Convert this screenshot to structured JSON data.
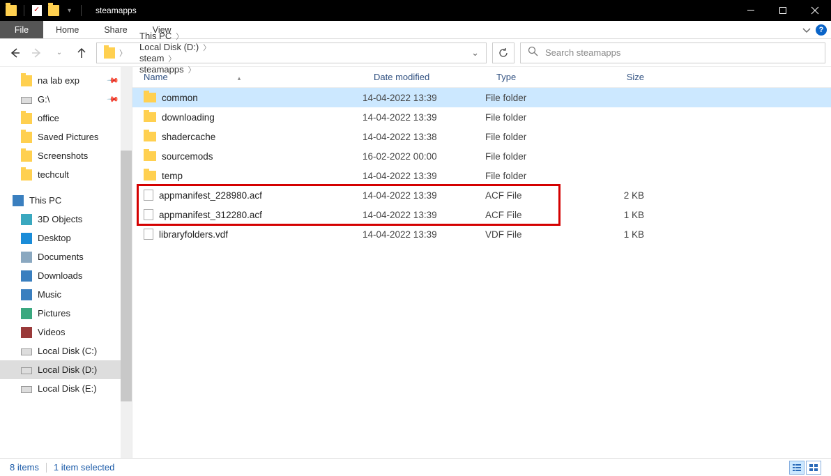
{
  "window": {
    "title": "steamapps"
  },
  "ribbon": {
    "file": "File",
    "home": "Home",
    "share": "Share",
    "view": "View"
  },
  "breadcrumbs": [
    "This PC",
    "Local Disk (D:)",
    "steam",
    "steamapps"
  ],
  "search": {
    "placeholder": "Search steamapps"
  },
  "sidebar": {
    "quick": [
      {
        "label": "na lab exp",
        "pinned": true,
        "icon": "folder"
      },
      {
        "label": "G:\\",
        "pinned": true,
        "icon": "drive"
      },
      {
        "label": "office",
        "pinned": false,
        "icon": "folder"
      },
      {
        "label": "Saved Pictures",
        "pinned": false,
        "icon": "folder"
      },
      {
        "label": "Screenshots",
        "pinned": false,
        "icon": "folder"
      },
      {
        "label": "techcult",
        "pinned": false,
        "icon": "folder"
      }
    ],
    "thispc_label": "This PC",
    "thispc": [
      {
        "label": "3D Objects",
        "icon": "obj"
      },
      {
        "label": "Desktop",
        "icon": "desk"
      },
      {
        "label": "Documents",
        "icon": "doc"
      },
      {
        "label": "Downloads",
        "icon": "dl"
      },
      {
        "label": "Music",
        "icon": "music"
      },
      {
        "label": "Pictures",
        "icon": "pic"
      },
      {
        "label": "Videos",
        "icon": "vid"
      },
      {
        "label": "Local Disk (C:)",
        "icon": "drive"
      },
      {
        "label": "Local Disk (D:)",
        "icon": "drive",
        "selected": true
      },
      {
        "label": "Local Disk (E:)",
        "icon": "drive"
      }
    ]
  },
  "columns": {
    "name": "Name",
    "date": "Date modified",
    "type": "Type",
    "size": "Size"
  },
  "files": [
    {
      "name": "common",
      "date": "14-04-2022 13:39",
      "type": "File folder",
      "size": "",
      "icon": "folder",
      "selected": true
    },
    {
      "name": "downloading",
      "date": "14-04-2022 13:39",
      "type": "File folder",
      "size": "",
      "icon": "folder"
    },
    {
      "name": "shadercache",
      "date": "14-04-2022 13:38",
      "type": "File folder",
      "size": "",
      "icon": "folder"
    },
    {
      "name": "sourcemods",
      "date": "16-02-2022 00:00",
      "type": "File folder",
      "size": "",
      "icon": "folder"
    },
    {
      "name": "temp",
      "date": "14-04-2022 13:39",
      "type": "File folder",
      "size": "",
      "icon": "folder"
    },
    {
      "name": "appmanifest_228980.acf",
      "date": "14-04-2022 13:39",
      "type": "ACF File",
      "size": "2 KB",
      "icon": "file"
    },
    {
      "name": "appmanifest_312280.acf",
      "date": "14-04-2022 13:39",
      "type": "ACF File",
      "size": "1 KB",
      "icon": "file"
    },
    {
      "name": "libraryfolders.vdf",
      "date": "14-04-2022 13:39",
      "type": "VDF File",
      "size": "1 KB",
      "icon": "file"
    }
  ],
  "highlight": {
    "row_start": 5,
    "row_end": 6
  },
  "status": {
    "items": "8 items",
    "selected": "1 item selected"
  }
}
